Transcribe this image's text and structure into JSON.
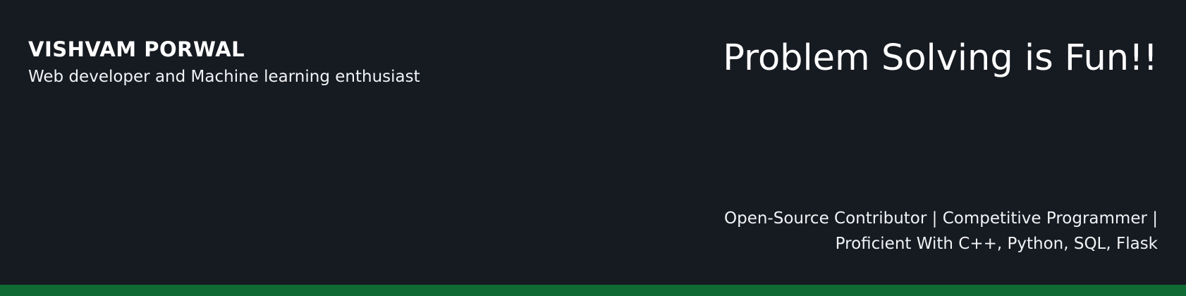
{
  "profile": {
    "name": "VISHVAM PORWAL",
    "tagline": "Web developer and Machine learning enthusiast"
  },
  "headline": "Problem Solving is Fun!!",
  "bio": {
    "line1": "Open-Source Contributor | Competitive Programmer |",
    "line2": "Proficient With C++, Python, SQL, Flask"
  },
  "colors": {
    "background": "#161a21",
    "text": "#ffffff",
    "accent_bar": "#0f6b33"
  }
}
